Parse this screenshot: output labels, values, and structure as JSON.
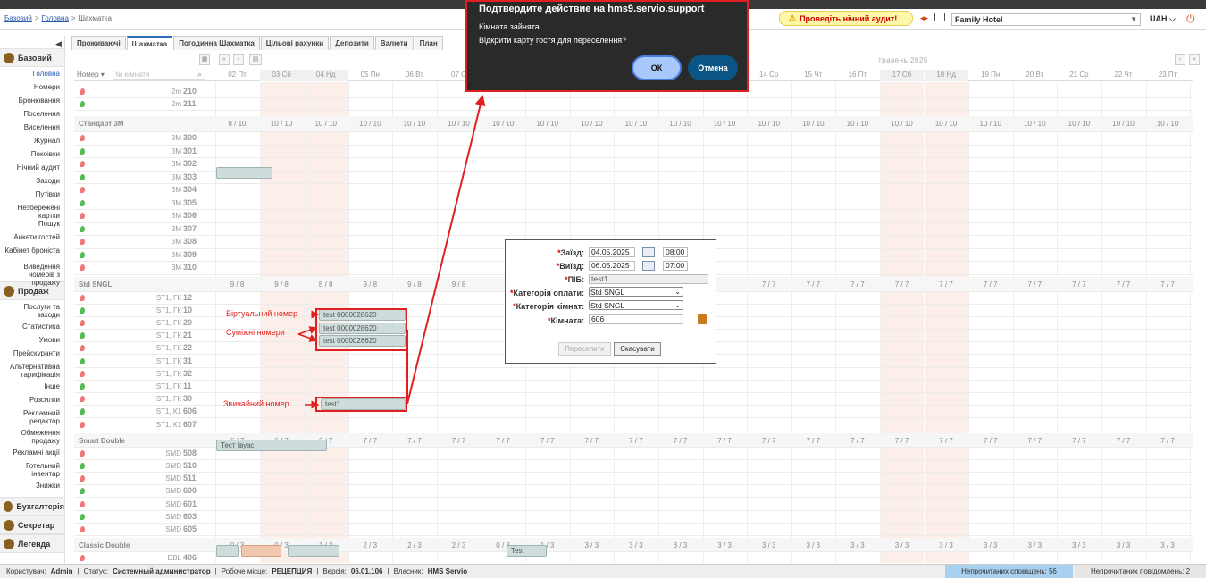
{
  "breadcrumb": {
    "base": "Базовий",
    "sep": ">",
    "home": "Головна",
    "sep2": ">",
    "current": "Шахматка"
  },
  "audit": {
    "label": "Проведіть нічний аудит!"
  },
  "hotel": {
    "name": "Family Hotel"
  },
  "currency": {
    "value": "UAH"
  },
  "icons": {
    "audit": "warning-icon",
    "power": "power-icon",
    "monitor": "monitor-icon",
    "arrows": "swap-arrows-icon"
  },
  "sidebar": {
    "sections": [
      {
        "label": "Базовий",
        "icon": "home-icon"
      },
      {
        "label": "Продаж",
        "icon": "sales-icon"
      },
      {
        "label": "Бухгалтерія",
        "icon": "accounting-icon"
      },
      {
        "label": "Секретар",
        "icon": "secretary-icon"
      },
      {
        "label": "Легенда",
        "icon": "legend-icon"
      }
    ],
    "base_items": [
      "Головна",
      "Номери",
      "Бронювання",
      "Поселення",
      "Виселення",
      "Журнал",
      "Покоівки",
      "Нічний аудит",
      "Заходи",
      "Путівки",
      "Незбережені картки",
      "Пошук",
      "Анкети гостей",
      "Кабінет броніста",
      "Виведення номерів з продажу"
    ],
    "sales_items": [
      "Послуги та заходи",
      "Статистика",
      "Умови",
      "Прейскуранти",
      "Альтернативна тарифікація",
      "Інше",
      "Розсилки",
      "Рекламний редактор",
      "Обмеження продажу",
      "Рекламні акції",
      "Готельний інвентар",
      "Знижки"
    ]
  },
  "tabs": [
    "Проживаючі",
    "Шахматка",
    "Погодинна Шахматка",
    "Цільові рахунки",
    "Депозити",
    "Валюти",
    "План"
  ],
  "grid": {
    "month": "травень 2025",
    "num_label": "Номер",
    "num_placeholder": "№ кімнати",
    "days": [
      "02 Пт",
      "03 Сб",
      "04 Нд",
      "05 Пн",
      "06 Вт",
      "07 С",
      "",
      "",
      "",
      "",
      "",
      "",
      "14 Ср",
      "15 Чт",
      "16 Пт",
      "17 Сб",
      "18 Нд",
      "19 Пн",
      "20 Вт",
      "21 Ср",
      "22 Чт",
      "23 Пт"
    ],
    "groups": [
      {
        "name": "Стандарт 3М",
        "occ": [
          "8 / 10",
          "10 / 10",
          "10 / 10",
          "10 / 10",
          "10 / 10",
          "10 / 10",
          "10 / 10",
          "10 / 10",
          "10 / 10",
          "10 / 10",
          "10 / 10",
          "10 / 10",
          "10 / 10",
          "10 / 10",
          "10 / 10",
          "10 / 10",
          "10 / 10",
          "10 / 10",
          "10 / 10",
          "10 / 10",
          "10 / 10",
          "10 / 10"
        ]
      },
      {
        "name": "Std SNGL",
        "occ": [
          "9 / 8",
          "9 / 8",
          "8 / 8",
          "9 / 8",
          "9 / 8",
          "9 / 8",
          "",
          "",
          "",
          "",
          "",
          "",
          "7 / 7",
          "7 / 7",
          "7 / 7",
          "7 / 7",
          "7 / 7",
          "7 / 7",
          "7 / 7",
          "7 / 7",
          "7 / 7",
          "7 / 7"
        ]
      },
      {
        "name": "Smart Double",
        "occ": [
          "6 / 7",
          "6 / 7",
          "6 / 7",
          "7 / 7",
          "7 / 7",
          "7 / 7",
          "7 / 7",
          "7 / 7",
          "7 / 7",
          "7 / 7",
          "7 / 7",
          "7 / 7",
          "7 / 7",
          "7 / 7",
          "7 / 7",
          "7 / 7",
          "7 / 7",
          "7 / 7",
          "7 / 7",
          "7 / 7",
          "7 / 7",
          "7 / 7"
        ]
      },
      {
        "name": "Classic Double",
        "occ": [
          "0 / 3",
          "0 / 3",
          "1 / 3",
          "2 / 3",
          "2 / 3",
          "2 / 3",
          "0 / 3",
          "1 / 3",
          "3 / 3",
          "3 / 3",
          "3 / 3",
          "3 / 3",
          "3 / 3",
          "3 / 3",
          "3 / 3",
          "3 / 3",
          "3 / 3",
          "3 / 3",
          "3 / 3",
          "3 / 3",
          "3 / 3",
          "3 / 3"
        ]
      }
    ],
    "rooms_top": [
      {
        "type": "2m",
        "num": "210"
      },
      {
        "type": "2m",
        "num": "211"
      }
    ],
    "rooms_3m": [
      {
        "type": "3M",
        "num": "300"
      },
      {
        "type": "3M",
        "num": "301"
      },
      {
        "type": "3M",
        "num": "302"
      },
      {
        "type": "3M",
        "num": "303"
      },
      {
        "type": "3M",
        "num": "304"
      },
      {
        "type": "3M",
        "num": "305"
      },
      {
        "type": "3M",
        "num": "306"
      },
      {
        "type": "3M",
        "num": "307"
      },
      {
        "type": "3M",
        "num": "308"
      },
      {
        "type": "3M",
        "num": "309"
      },
      {
        "type": "3M",
        "num": "310"
      }
    ],
    "rooms_sngl": [
      {
        "type": "ST1, ГК",
        "num": "12"
      },
      {
        "type": "ST1, ГК",
        "num": "10"
      },
      {
        "type": "ST1, ГК",
        "num": "20"
      },
      {
        "type": "ST1, ГК",
        "num": "21"
      },
      {
        "type": "ST1, ГК",
        "num": "22"
      },
      {
        "type": "ST1, ГК",
        "num": "31"
      },
      {
        "type": "ST1, ГК",
        "num": "32"
      },
      {
        "type": "ST1, ГК",
        "num": "11"
      },
      {
        "type": "ST1, ГК",
        "num": "30"
      },
      {
        "type": "ST1, К1",
        "num": "606"
      },
      {
        "type": "ST1, К1",
        "num": "607"
      }
    ],
    "rooms_smd": [
      {
        "type": "SMD",
        "num": "508"
      },
      {
        "type": "SMD",
        "num": "510"
      },
      {
        "type": "SMD",
        "num": "511"
      },
      {
        "type": "SMD",
        "num": "600"
      },
      {
        "type": "SMD",
        "num": "601"
      },
      {
        "type": "SMD",
        "num": "603"
      },
      {
        "type": "SMD",
        "num": "605"
      }
    ],
    "rooms_dbl": [
      {
        "type": "DBL",
        "num": "406"
      }
    ],
    "bookings": {
      "b303": "",
      "virt": "test 0000028620",
      "adj1": "test 0000028620",
      "adj2": "test 0000028620",
      "normal": "test1",
      "smd508": "Тест Івуас",
      "dbl_test": "Test"
    }
  },
  "annotations": {
    "virtual": "Віртуальний номер",
    "adjacent": "Суміжні номери",
    "regular": "Звичайний номер"
  },
  "confirm": {
    "title": "Подтвердите действие на hms9.servio.support",
    "line1": "Кімната зайнята",
    "line2": "Відкрити карту гостя для переселення?",
    "ok": "ОК",
    "cancel": "Отмена"
  },
  "move_form": {
    "checkin_label": "Заїзд:",
    "checkin_date": "04.05.2025",
    "checkin_time": "08:00",
    "checkout_label": "Виїзд:",
    "checkout_date": "06.05.2025",
    "checkout_time": "07:00",
    "name_label": "ПІБ:",
    "name_value": "test1",
    "pay_label": "Категорія оплати:",
    "pay_value": "Std SNGL",
    "cat_label": "Категорія кімнат:",
    "cat_value": "Std SNGL",
    "room_label": "Кімната:",
    "room_value": "606",
    "move_btn": "Переселити",
    "cancel_btn": "Скасувати"
  },
  "status": {
    "user_label": "Користувач:",
    "user": "Admin",
    "status_label": "Статус:",
    "status": "Системный администратор",
    "place_label": "Робоче місце:",
    "place": "РЕЦЕПЦИЯ",
    "version_label": "Версія:",
    "version": "06.01.106",
    "owner_label": "Власник:",
    "owner": "HMS Servio",
    "notif_unread": "Непрочитаних сповіщень: 56",
    "msg_unread": "Непрочитаних повідомлень: 2"
  }
}
